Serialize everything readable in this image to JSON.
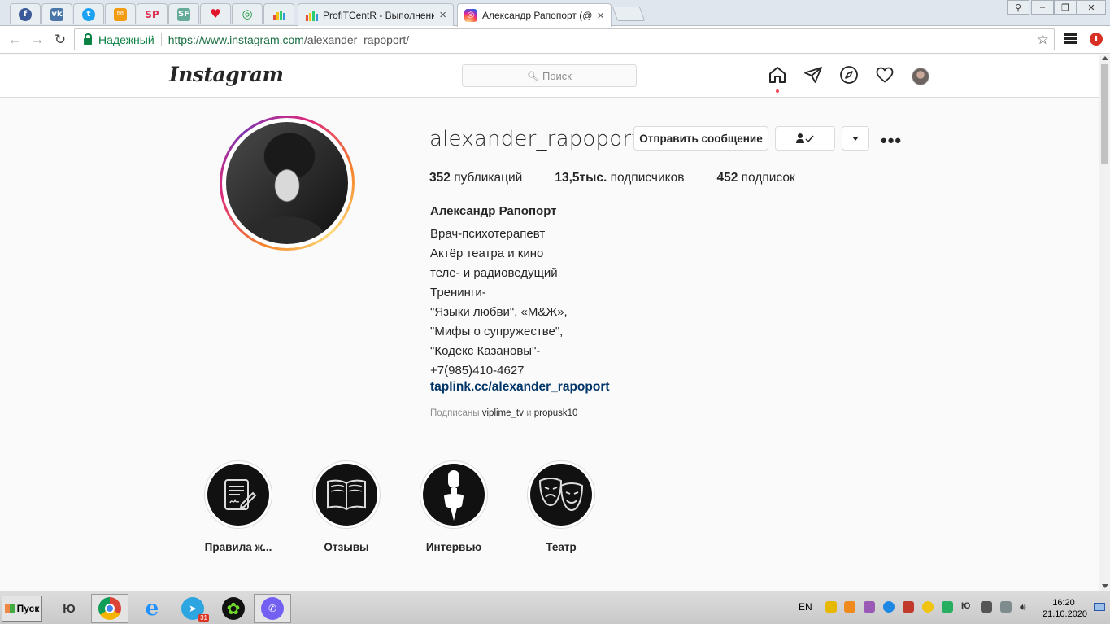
{
  "browser": {
    "tabs": [
      {
        "title": "ProfiTCentR - Выполнение",
        "icon": "chart-icon"
      },
      {
        "title": "Александр Рапопорт (@al",
        "icon": "instagram-icon",
        "active": true
      }
    ],
    "pinned_icons": [
      "facebook-icon",
      "vk-icon",
      "twitter-icon",
      "mail-icon",
      "sp-icon",
      "sf-icon",
      "heart-icon",
      "spiral-icon",
      "chart-icon"
    ],
    "secure_label": "Надежный",
    "url_host": "https://www.instagram.com",
    "url_path": "/alexander_rapoport/",
    "colors": {
      "secure": "#0b8043",
      "tab_active": "#ffffff"
    }
  },
  "instagram": {
    "logo": "Instagram",
    "search_placeholder": "Поиск",
    "nav_icons": [
      "home-icon",
      "direct-icon",
      "explore-icon",
      "activity-heart-icon",
      "profile-avatar"
    ]
  },
  "profile": {
    "username": "alexander_rapoport",
    "send_message": "Отправить сообщение",
    "follow_icon": "person-check-icon",
    "posts_count": "352",
    "posts_label": "публикаций",
    "followers_count": "13,5тыс.",
    "followers_label": "подписчиков",
    "following_count": "452",
    "following_label": "подписок",
    "full_name": "Александр Рапопорт",
    "bio_lines": [
      "Врач-психотерапевт",
      "Актёр театра и кино",
      "теле- и радиоведущий",
      "Тренинги-",
      "\"Языки любви\", «М&Ж»,",
      "\"Мифы о супружестве\",",
      "\"Кодекс Казановы\"-",
      "+7(985)410-4627"
    ],
    "link": "taplink.cc/alexander_rapoport",
    "followed_by_prefix": "Подписаны",
    "followed_by_1": "viplime_tv",
    "followed_by_sep": "и",
    "followed_by_2": "propusk10"
  },
  "highlights": [
    {
      "label": "Правила ж...",
      "icon": "document-signature-icon"
    },
    {
      "label": "Отзывы",
      "icon": "open-book-icon"
    },
    {
      "label": "Интервью",
      "icon": "microphone-icon"
    },
    {
      "label": "Театр",
      "icon": "theater-masks-icon"
    }
  ],
  "taskbar": {
    "start_label": "Пуск",
    "apps": [
      "yu-icon",
      "chrome-icon",
      "ie-icon",
      "telegram-icon",
      "icq-icon",
      "viber-icon"
    ],
    "telegram_badge": "31",
    "language": "EN",
    "time": "16:20",
    "date": "21.10.2020"
  }
}
